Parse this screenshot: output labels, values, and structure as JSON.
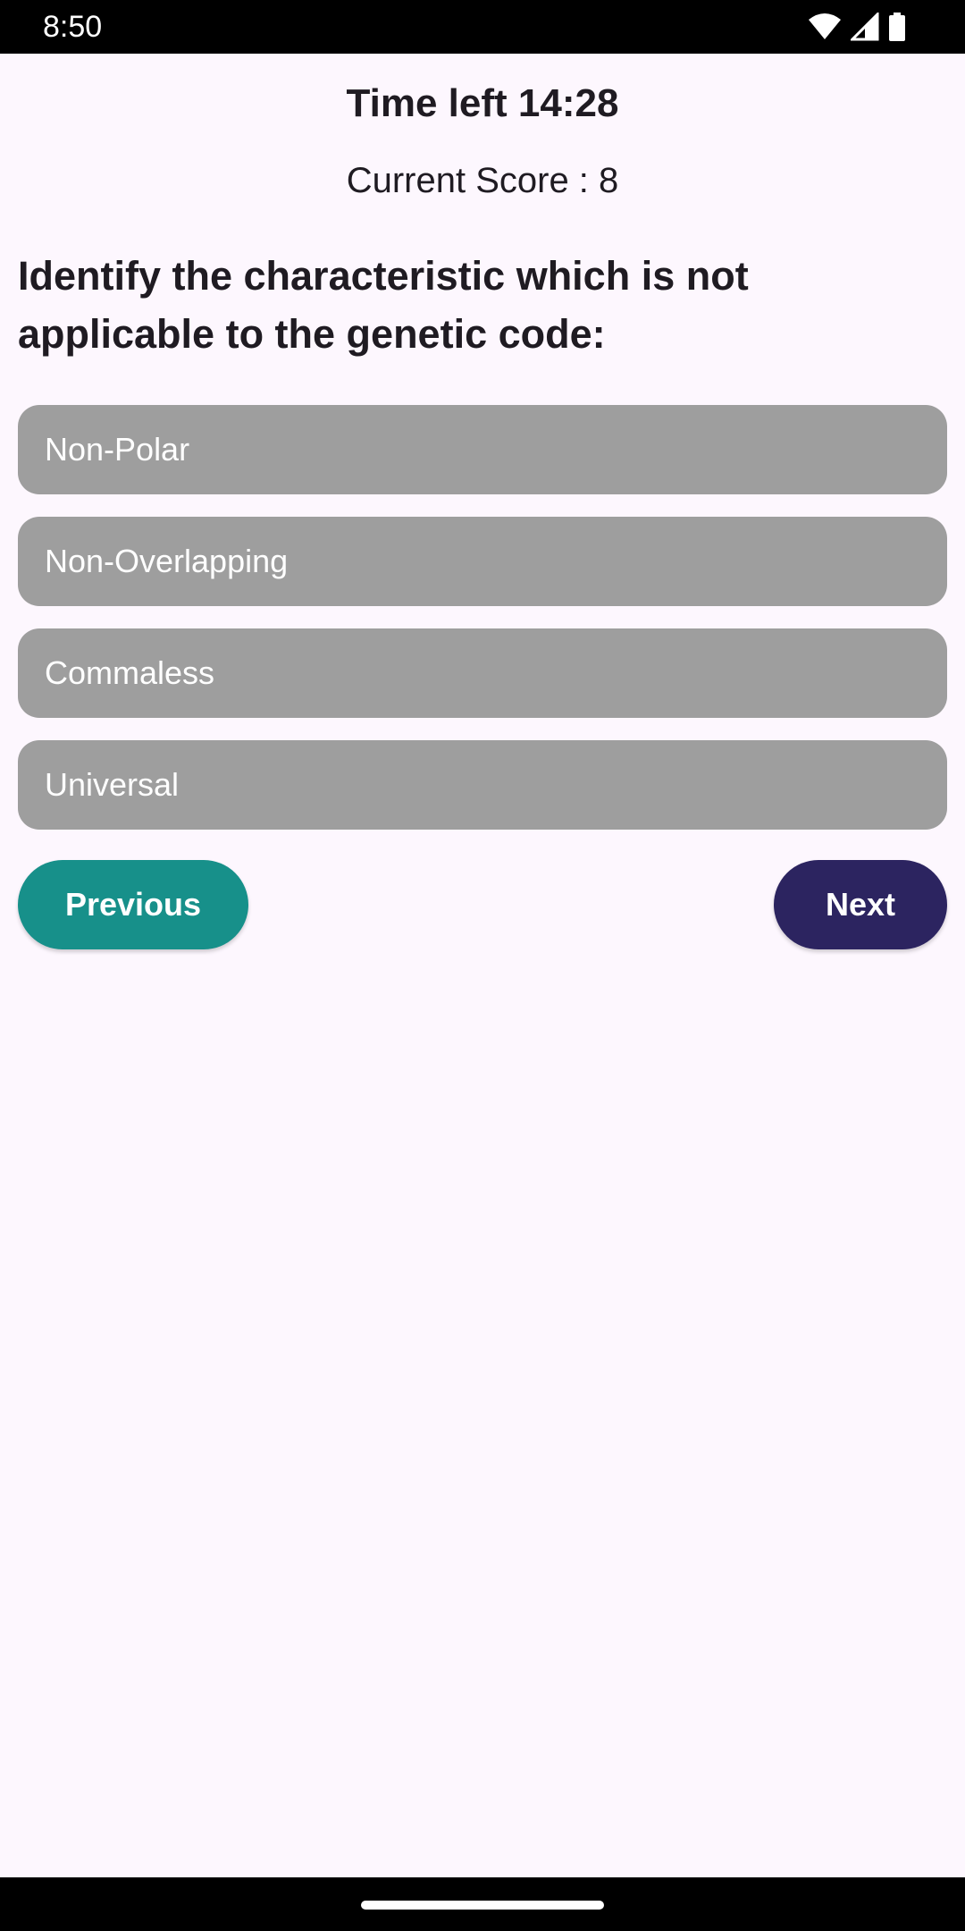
{
  "status_bar": {
    "time": "8:50",
    "icons": [
      "wifi-icon",
      "signal-icon",
      "battery-icon"
    ]
  },
  "quiz": {
    "timer_text": "Time left 14:28",
    "score_text": "Current Score : 8",
    "question": "Identify the characteristic which is not applicable to the genetic code:",
    "options": [
      "Non-Polar",
      "Non-Overlapping",
      "Commaless",
      "Universal"
    ]
  },
  "buttons": {
    "previous_label": "Previous",
    "next_label": "Next"
  },
  "colors": {
    "background": "#fdf7fe",
    "option_bg": "#9e9e9e",
    "previous_bg": "#17908a",
    "next_bg": "#2c2460"
  }
}
